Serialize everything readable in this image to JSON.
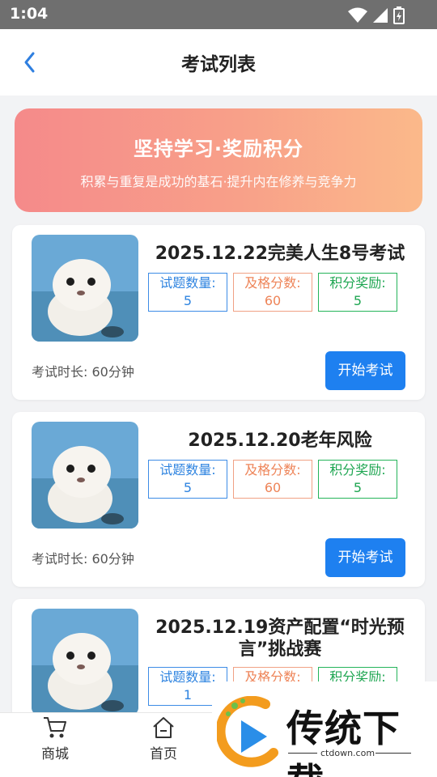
{
  "status_bar": {
    "time": "1:04"
  },
  "header": {
    "title": "考试列表"
  },
  "banner": {
    "title": "坚持学习·奖励积分",
    "subtitle": "积累与重复是成功的基石·提升内在修养与竞争力"
  },
  "exams": [
    {
      "title": "2025.12.22完美人生8号考试",
      "question_count_label": "试题数量:",
      "question_count": "5",
      "pass_score_label": "及格分数:",
      "pass_score": "60",
      "reward_label": "积分奖励:",
      "reward": "5",
      "duration": "考试时长: 60分钟",
      "start_label": "开始考试"
    },
    {
      "title": "2025.12.20老年风险",
      "question_count_label": "试题数量:",
      "question_count": "5",
      "pass_score_label": "及格分数:",
      "pass_score": "60",
      "reward_label": "积分奖励:",
      "reward": "5",
      "duration": "考试时长: 60分钟",
      "start_label": "开始考试"
    },
    {
      "title": "2025.12.19资产配置“时光预言”挑战赛",
      "question_count_label": "试题数量:",
      "question_count": "1",
      "pass_score_label": "及格分数:",
      "pass_score": "",
      "reward_label": "积分奖励:",
      "reward": "",
      "duration": "",
      "start_label": ""
    }
  ],
  "tabbar": {
    "items": [
      {
        "label": "商城",
        "icon": "cart-icon"
      },
      {
        "label": "首页",
        "icon": "home-icon"
      }
    ]
  },
  "watermark": {
    "text": "传统下载",
    "url": "ctdown.com"
  },
  "colors": {
    "primary": "#1e80f0",
    "banner_start": "#f58a8a",
    "banner_end": "#fbb98a",
    "stat_blue": "#2f84e0",
    "stat_orange": "#ee8458",
    "stat_green": "#1fa652"
  }
}
